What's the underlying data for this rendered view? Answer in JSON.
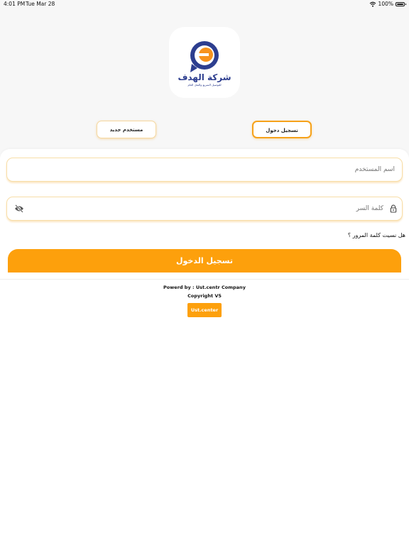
{
  "status_bar": {
    "time": "4:01 PM",
    "date": "Tue Mar 28",
    "battery": "100%",
    "battery_level": 1.0
  },
  "logo": {
    "title": "شركة الهدف",
    "subtitle": "للتوصيل السريع والنقل العام",
    "colors": {
      "navy": "#2d3e8f",
      "orange": "#f7931e"
    }
  },
  "tabs": {
    "login_label": "تسجيل دخول",
    "new_user_label": "مستخدم جديد"
  },
  "form": {
    "username_placeholder": "اسم المستخدم",
    "username_value": "",
    "password_placeholder": "كلمة السر",
    "password_value": "",
    "forgot_password": "هل نسيت كلمة المرور ؟",
    "login_button": "تسجيل الدخول"
  },
  "icons": {
    "lock": "lock-icon",
    "eye": "eye-off-icon",
    "wifi": "wifi-icon",
    "battery": "battery-icon"
  },
  "footer": {
    "powered_by": "Powerd by : Ust.centr Company",
    "copyright": "Copyright V5",
    "ust_button": "Ust.center"
  },
  "colors": {
    "accent": "#fda00c",
    "field_border": "#f8dea8",
    "background": "#f7f7f7"
  }
}
